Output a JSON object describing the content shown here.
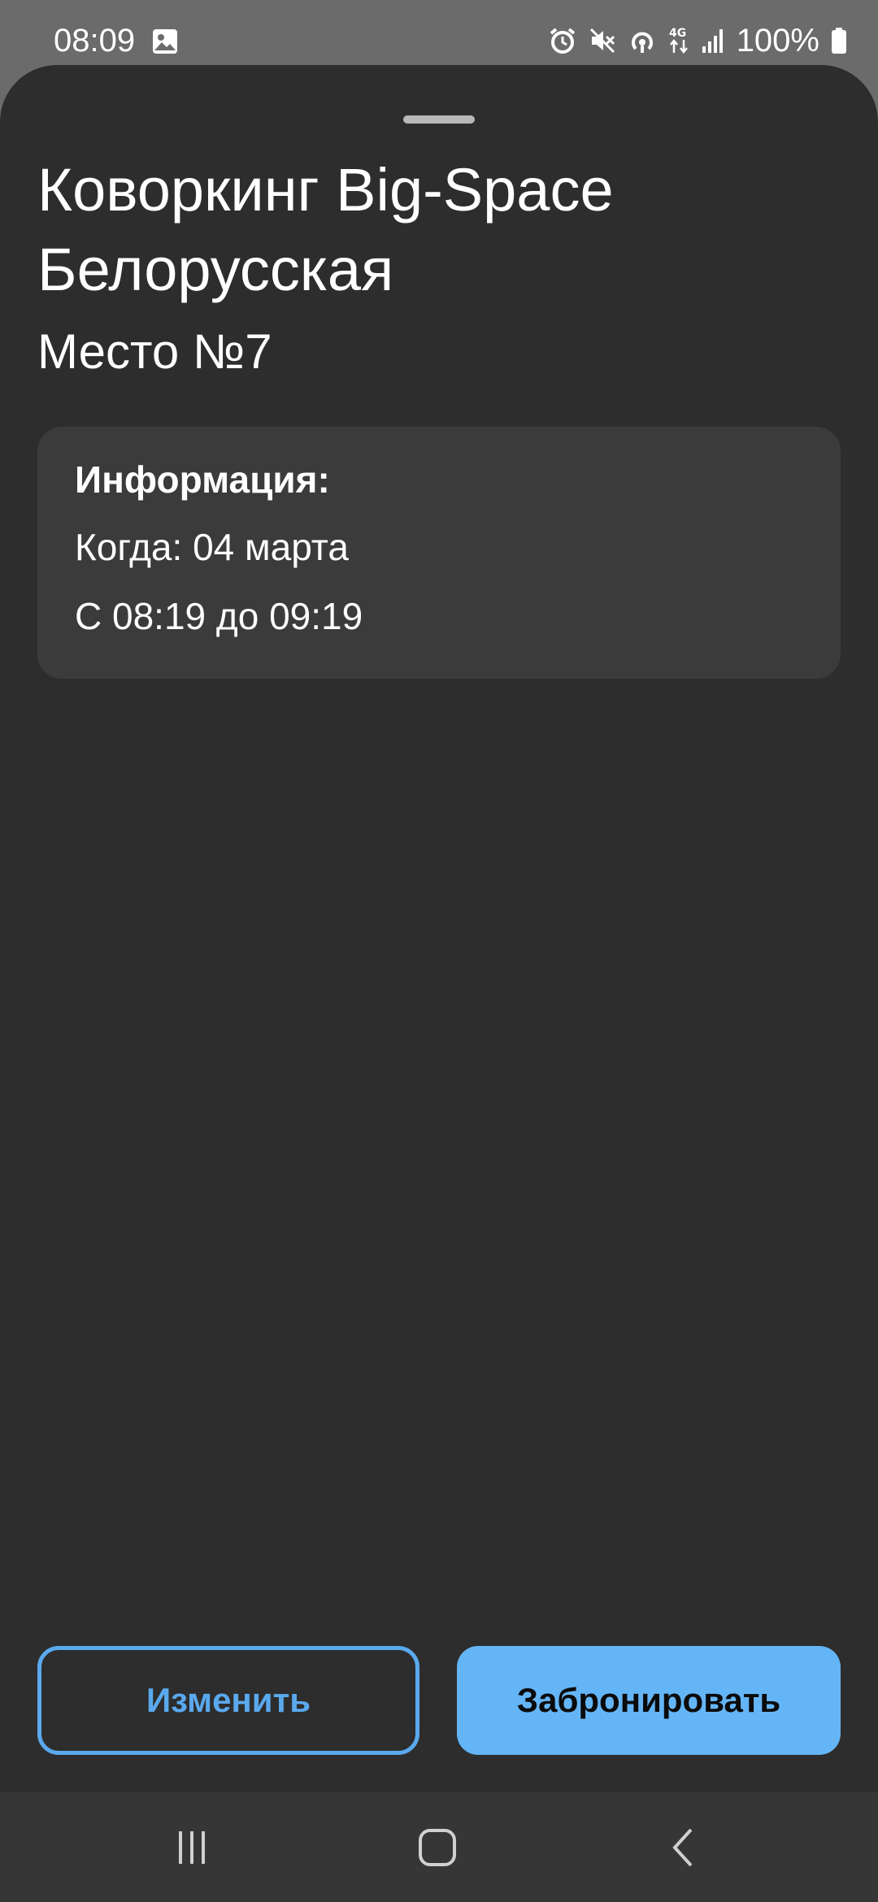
{
  "status_bar": {
    "time": "08:09",
    "battery": "100%",
    "icons": [
      "image-icon",
      "alarm-icon",
      "mute-icon",
      "hotspot-icon",
      "4g-icon",
      "signal-icon",
      "battery-icon"
    ]
  },
  "booking": {
    "title": "Коворкинг Big-Space Белорусская",
    "seat": "Место №7",
    "info_heading": "Информация:",
    "when": "Когда: 04 марта",
    "time_range": "С 08:19 до 09:19"
  },
  "actions": {
    "change_label": "Изменить",
    "book_label": "Забронировать"
  },
  "navigation": {
    "icons": [
      "recents-icon",
      "home-icon",
      "back-icon"
    ]
  },
  "colors": {
    "sheet_background": "#2d2d2d",
    "card_background": "#3b3b3b",
    "accent": "#64b5f6",
    "outline_button": "#5aa9ee"
  }
}
